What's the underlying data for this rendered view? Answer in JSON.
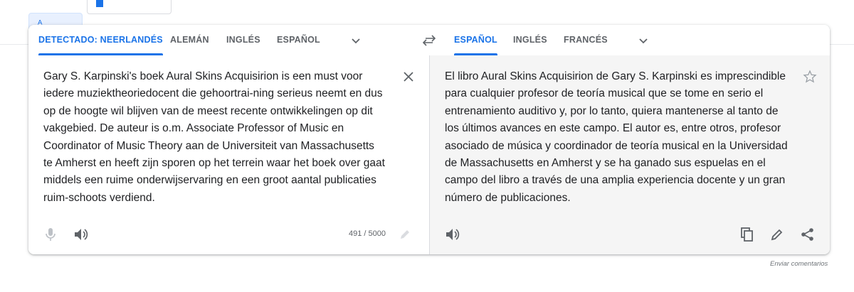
{
  "colors": {
    "accent": "#1a73e8",
    "icon": "#5f6368",
    "target_bg": "#f5f5f5"
  },
  "source_langs": [
    {
      "label": "DETECTADO: NEERLANDÉS",
      "active": true
    },
    {
      "label": "ALEMÁN",
      "active": false
    },
    {
      "label": "INGLÉS",
      "active": false
    },
    {
      "label": "ESPAÑOL",
      "active": false
    }
  ],
  "target_langs": [
    {
      "label": "ESPAÑOL",
      "active": true
    },
    {
      "label": "INGLÉS",
      "active": false
    },
    {
      "label": "FRANCÉS",
      "active": false
    }
  ],
  "source": {
    "lines": [
      "Gary S. Karpinski's boek Aural Skins Acquisirion is een must voor",
      "iedere muziektheoriedocent die gehoortrai-ning serieus neemt en dus",
      "op de hoogte wil blijven van de meest recente ontwikkelingen op dit",
      "vakgebied. De auteur is o.m. Associate Professor of Music en",
      "Coordinator of Music Theory aan de Universiteit van Massachusetts",
      "te Amherst en heeft zijn sporen op het terrein waar het boek over gaat",
      "middels een ruime onderwijservaring en een groot aantal publicaties",
      "ruim-schoots verdiend."
    ],
    "char_count": "491 / 5000"
  },
  "target": {
    "lines": [
      "El libro Aural Skins Acquisirion de Gary S. Karpinski es imprescindible",
      "para cualquier profesor de teoría musical que se tome en serio el",
      "entrenamiento auditivo y, por lo tanto, quiera mantenerse al tanto de",
      "los últimos avances en este campo. El autor es, entre otros, profesor",
      "asociado de música y coordinador de teoría musical en la Universidad",
      "de Massachusetts en Amherst y se ha ganado sus espuelas en el",
      "campo del libro a través de una amplia experiencia docente y un gran",
      "número de publicaciones."
    ]
  },
  "icons": {
    "swap": "swap-languages-icon",
    "clear": "close-icon",
    "star": "star-outline-icon",
    "mic": "microphone-icon",
    "speaker": "speaker-icon",
    "pencil": "pencil-icon",
    "copy": "copy-icon",
    "edit": "edit-icon",
    "share": "share-icon"
  },
  "feedback_label": "Enviar comentarios"
}
